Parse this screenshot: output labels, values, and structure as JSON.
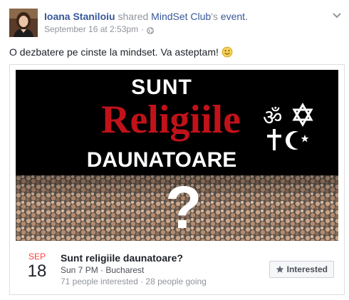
{
  "post": {
    "author_name": "Ioana Staniloiu",
    "shared_text": "shared",
    "page_name": "MindSet Club",
    "possessive_suffix": "'s",
    "event_word": "event.",
    "timestamp": "September 16 at 2:53pm",
    "separator": "·",
    "privacy_icon": "globe-icon",
    "message": "O dezbatere pe cinste la mindset. Va asteptam!",
    "message_emoji": "smiley-icon"
  },
  "cover": {
    "line1": "SUNT",
    "line2": "Religiile",
    "line3": "DAUNATOARE",
    "question_mark": "?",
    "symbols": [
      "om-icon",
      "star-of-david-icon",
      "cross-icon",
      "crescent-star-icon"
    ]
  },
  "event": {
    "month": "SEP",
    "day": "18",
    "title": "Sunt religiile daunatoare?",
    "when": "Sun 7 PM · Bucharest",
    "stats": "71 people interested · 28 people going",
    "button_label": "Interested",
    "button_icon": "star-icon"
  },
  "colors": {
    "link": "#365899",
    "muted": "#90949c",
    "month_red": "#fa3e3e",
    "cover_red": "#c1121a"
  }
}
